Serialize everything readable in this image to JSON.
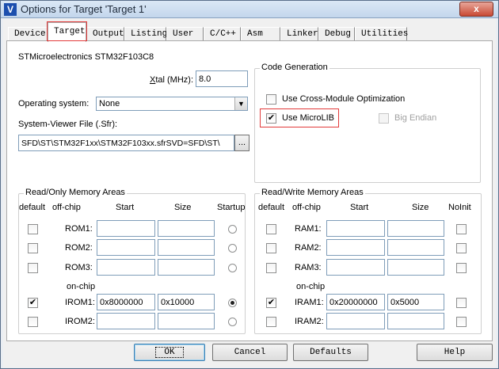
{
  "window": {
    "title": "Options for Target 'Target 1'",
    "close_glyph": "x"
  },
  "tabs": [
    {
      "label": "Device"
    },
    {
      "label": "Target"
    },
    {
      "label": "Output"
    },
    {
      "label": "Listing"
    },
    {
      "label": "User"
    },
    {
      "label": "C/C++"
    },
    {
      "label": "Asm"
    },
    {
      "label": "Linker"
    },
    {
      "label": "Debug"
    },
    {
      "label": "Utilities"
    }
  ],
  "active_tab": "Target",
  "device_name": "STMicroelectronics STM32F103C8",
  "xtal": {
    "label_prefix": "X",
    "label_rest": "tal (MHz):",
    "value": "8.0"
  },
  "os": {
    "label": "Operating system:",
    "value": "None"
  },
  "sfr": {
    "label": "System-Viewer File (.Sfr):",
    "value": "SFD\\ST\\STM32F1xx\\STM32F103xx.sfrSVD=SFD\\ST\\",
    "browse": "..."
  },
  "code_gen": {
    "title": "Code Generation",
    "cross_module": {
      "label": "Use Cross-Module Optimization",
      "checked": false
    },
    "microlib": {
      "label": "Use MicroLIB",
      "checked": true
    },
    "big_endian": {
      "label": "Big Endian",
      "checked": false,
      "enabled": false
    }
  },
  "rom": {
    "title": "Read/Only Memory Areas",
    "headers": {
      "default": "default",
      "offchip": "off-chip",
      "start": "Start",
      "size": "Size",
      "startup": "Startup"
    },
    "onchip_label": "on-chip",
    "rows": [
      {
        "name": "ROM1:",
        "default": false,
        "start": "",
        "size": "",
        "startup": false
      },
      {
        "name": "ROM2:",
        "default": false,
        "start": "",
        "size": "",
        "startup": false
      },
      {
        "name": "ROM3:",
        "default": false,
        "start": "",
        "size": "",
        "startup": false
      },
      {
        "name": "IROM1:",
        "default": true,
        "start": "0x8000000",
        "size": "0x10000",
        "startup": true
      },
      {
        "name": "IROM2:",
        "default": false,
        "start": "",
        "size": "",
        "startup": false
      }
    ]
  },
  "ram": {
    "title": "Read/Write Memory Areas",
    "headers": {
      "default": "default",
      "offchip": "off-chip",
      "start": "Start",
      "size": "Size",
      "noinit": "NoInit"
    },
    "onchip_label": "on-chip",
    "rows": [
      {
        "name": "RAM1:",
        "default": false,
        "start": "",
        "size": "",
        "noinit": false
      },
      {
        "name": "RAM2:",
        "default": false,
        "start": "",
        "size": "",
        "noinit": false
      },
      {
        "name": "RAM3:",
        "default": false,
        "start": "",
        "size": "",
        "noinit": false
      },
      {
        "name": "IRAM1:",
        "default": true,
        "start": "0x20000000",
        "size": "0x5000",
        "noinit": false
      },
      {
        "name": "IRAM2:",
        "default": false,
        "start": "",
        "size": "",
        "noinit": false
      }
    ]
  },
  "buttons": {
    "ok": "OK",
    "cancel": "Cancel",
    "defaults": "Defaults",
    "help": "Help"
  },
  "check_glyph": "✔"
}
